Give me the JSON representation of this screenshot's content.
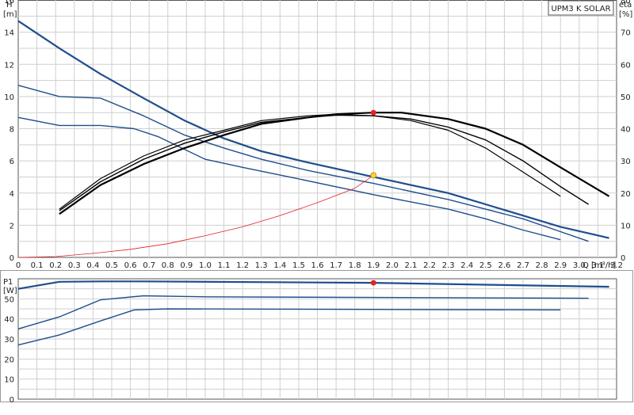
{
  "chart_data": [
    {
      "type": "line",
      "title": "UPM3 K SOLAR",
      "xlabel": "Q [m³/h]",
      "ylabel": "H [m]",
      "ylabel2": "eta [%]",
      "xlim": [
        0,
        3.2
      ],
      "ylim": [
        0,
        16
      ],
      "ylim2": [
        0,
        80
      ],
      "x_ticks": [
        "0",
        "0.1",
        "0.2",
        "0.3",
        "0.4",
        "0.5",
        "0.6",
        "0.7",
        "0.8",
        "0.9",
        "1.0",
        "1.1",
        "1.2",
        "1.3",
        "1.4",
        "1.5",
        "1.6",
        "1.7",
        "1.8",
        "1.9",
        "2.0",
        "2.1",
        "2.2",
        "2.3",
        "2.4",
        "2.5",
        "2.6",
        "2.7",
        "2.8",
        "2.9",
        "3.0",
        "3.1",
        "3.2"
      ],
      "y_ticks": [
        "0",
        "2",
        "4",
        "6",
        "8",
        "10",
        "12",
        "14",
        "16"
      ],
      "y2_ticks": [
        "0",
        "10",
        "20",
        "30",
        "40",
        "50",
        "60",
        "70",
        "80"
      ],
      "grid": true,
      "series": [
        {
          "axis": "H",
          "color": "#1f4e8c",
          "width": 2.2,
          "x": [
            0,
            0.22,
            0.44,
            0.67,
            0.89,
            1.1,
            1.3,
            1.55,
            1.9,
            2.3,
            2.5,
            2.7,
            2.9,
            3.16
          ],
          "y": [
            14.7,
            13.0,
            11.4,
            9.9,
            8.5,
            7.4,
            6.6,
            5.9,
            5.0,
            4.0,
            3.3,
            2.6,
            1.9,
            1.2
          ]
        },
        {
          "axis": "H",
          "color": "#1f4e8c",
          "width": 1.4,
          "x": [
            0,
            0.22,
            0.44,
            0.67,
            0.89,
            1.1,
            1.3,
            1.55,
            1.9,
            2.3,
            2.5,
            2.7,
            2.9,
            3.05
          ],
          "y": [
            10.7,
            10.0,
            9.9,
            8.8,
            7.6,
            6.8,
            6.1,
            5.4,
            4.6,
            3.6,
            3.0,
            2.4,
            1.6,
            1.0
          ]
        },
        {
          "axis": "H",
          "color": "#1f4e8c",
          "width": 1.4,
          "x": [
            0,
            0.22,
            0.44,
            0.62,
            0.75,
            1.0,
            1.2,
            1.45,
            1.9,
            2.3,
            2.5,
            2.7,
            2.9
          ],
          "y": [
            8.7,
            8.2,
            8.2,
            8.0,
            7.5,
            6.1,
            5.6,
            5.0,
            3.9,
            3.0,
            2.4,
            1.7,
            1.1
          ]
        },
        {
          "axis": "H",
          "color": "#e02020",
          "width": 0.8,
          "x": [
            0,
            0.2,
            0.4,
            0.6,
            0.8,
            1.0,
            1.2,
            1.4,
            1.6,
            1.8,
            1.9
          ],
          "y": [
            0,
            0.05,
            0.25,
            0.5,
            0.85,
            1.35,
            1.9,
            2.6,
            3.4,
            4.3,
            5.1
          ]
        },
        {
          "axis": "eta",
          "color": "#000000",
          "width": 2.2,
          "x": [
            0.22,
            0.44,
            0.67,
            0.89,
            1.1,
            1.3,
            1.55,
            1.7,
            1.9,
            2.05,
            2.3,
            2.5,
            2.7,
            2.9,
            3.16
          ],
          "y": [
            13.5,
            22.5,
            29,
            34,
            38,
            41.5,
            43.5,
            44.5,
            45,
            45,
            43,
            40,
            35,
            28,
            19
          ]
        },
        {
          "axis": "eta",
          "color": "#000000",
          "width": 1.4,
          "x": [
            0.22,
            0.44,
            0.67,
            0.89,
            1.1,
            1.3,
            1.55,
            1.7,
            1.9,
            2.1,
            2.3,
            2.5,
            2.7,
            2.9,
            3.05
          ],
          "y": [
            14.5,
            23.5,
            30.5,
            35.5,
            39,
            42,
            43.5,
            44.2,
            44,
            43,
            40.5,
            36.5,
            30,
            22,
            16.5
          ]
        },
        {
          "axis": "eta",
          "color": "#000000",
          "width": 1.2,
          "x": [
            0.22,
            0.44,
            0.67,
            0.89,
            1.1,
            1.3,
            1.55,
            1.7,
            1.9,
            2.1,
            2.3,
            2.5,
            2.7,
            2.9
          ],
          "y": [
            15,
            24.5,
            31.5,
            36.5,
            39.5,
            42.5,
            44,
            44.5,
            44,
            42.5,
            39.5,
            34,
            26.5,
            19
          ]
        }
      ],
      "points": [
        {
          "axis": "eta",
          "x": 1.9,
          "y": 45,
          "color": "#e82020"
        },
        {
          "axis": "H",
          "x": 1.9,
          "y": 5.1,
          "color": "#ffd23c"
        }
      ]
    },
    {
      "type": "line",
      "title": "",
      "xlabel": "",
      "ylabel": "P1 [W]",
      "xlim": [
        0,
        3.2
      ],
      "ylim": [
        0,
        60
      ],
      "y_ticks": [
        "0",
        "10",
        "20",
        "30",
        "40",
        "50"
      ],
      "grid": true,
      "series": [
        {
          "color": "#1f4e8c",
          "width": 2.2,
          "x": [
            0,
            0.22,
            0.44,
            0.67,
            1.9,
            3.16
          ],
          "y": [
            55,
            58.5,
            58.7,
            58.7,
            58,
            56
          ]
        },
        {
          "color": "#1f4e8c",
          "width": 1.4,
          "x": [
            0,
            0.22,
            0.44,
            0.67,
            1.0,
            3.05
          ],
          "y": [
            35,
            41,
            49.5,
            51.5,
            51,
            50.3
          ]
        },
        {
          "color": "#1f4e8c",
          "width": 1.4,
          "x": [
            0,
            0.22,
            0.44,
            0.62,
            0.8,
            2.9
          ],
          "y": [
            27,
            32,
            39,
            44.5,
            45,
            44.5
          ]
        }
      ],
      "points": [
        {
          "x": 1.9,
          "y": 58,
          "color": "#e82020"
        }
      ]
    }
  ]
}
